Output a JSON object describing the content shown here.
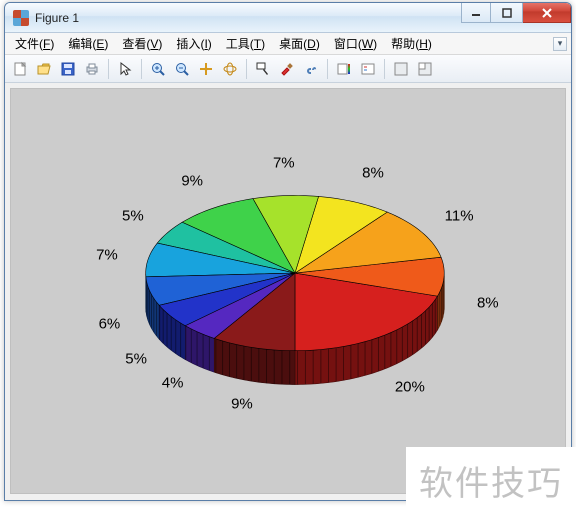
{
  "window": {
    "title": "Figure 1"
  },
  "menu": {
    "file": {
      "label": "文件",
      "key": "F"
    },
    "edit": {
      "label": "编辑",
      "key": "E"
    },
    "view": {
      "label": "查看",
      "key": "V"
    },
    "insert": {
      "label": "插入",
      "key": "I"
    },
    "tools": {
      "label": "工具",
      "key": "T"
    },
    "desktop": {
      "label": "桌面",
      "key": "D"
    },
    "window2": {
      "label": "窗口",
      "key": "W"
    },
    "help": {
      "label": "帮助",
      "key": "H"
    }
  },
  "toolbar_icons": [
    "new",
    "open",
    "save",
    "print",
    "|",
    "pointer",
    "|",
    "zoom-in",
    "zoom-out",
    "pan",
    "rotate3d",
    "|",
    "data-cursor",
    "brush",
    "link",
    "|",
    "colorbar",
    "legend",
    "|",
    "axes-new",
    "axes-sub"
  ],
  "labels": {
    "s1": "20%",
    "s2": "8%",
    "s3": "11%",
    "s4": "8%",
    "s5": "7%",
    "s6": "9%",
    "s7": "5%",
    "s8": "7%",
    "s9": "6%",
    "s10": "5%",
    "s11": "4%",
    "s12": "9%"
  },
  "watermark": "软件技巧",
  "chart_data": {
    "type": "pie",
    "title": "",
    "slices": [
      {
        "label": "20%",
        "value": 20,
        "color": "#d6201e"
      },
      {
        "label": "8%",
        "value": 8,
        "color": "#ef5a1a"
      },
      {
        "label": "11%",
        "value": 11,
        "color": "#f6a21b"
      },
      {
        "label": "8%",
        "value": 8,
        "color": "#f3e41f"
      },
      {
        "label": "7%",
        "value": 7,
        "color": "#a6e22b"
      },
      {
        "label": "9%",
        "value": 9,
        "color": "#3fd24a"
      },
      {
        "label": "5%",
        "value": 5,
        "color": "#1fc1a1"
      },
      {
        "label": "7%",
        "value": 7,
        "color": "#18a3dd"
      },
      {
        "label": "6%",
        "value": 6,
        "color": "#1f62d6"
      },
      {
        "label": "5%",
        "value": 5,
        "color": "#2233c9"
      },
      {
        "label": "4%",
        "value": 4,
        "color": "#5528c0"
      },
      {
        "label": "9%",
        "value": 9,
        "color": "#8a1a1a"
      }
    ],
    "style_3d": true,
    "start_angle_deg": 90,
    "direction": "clockwise"
  }
}
